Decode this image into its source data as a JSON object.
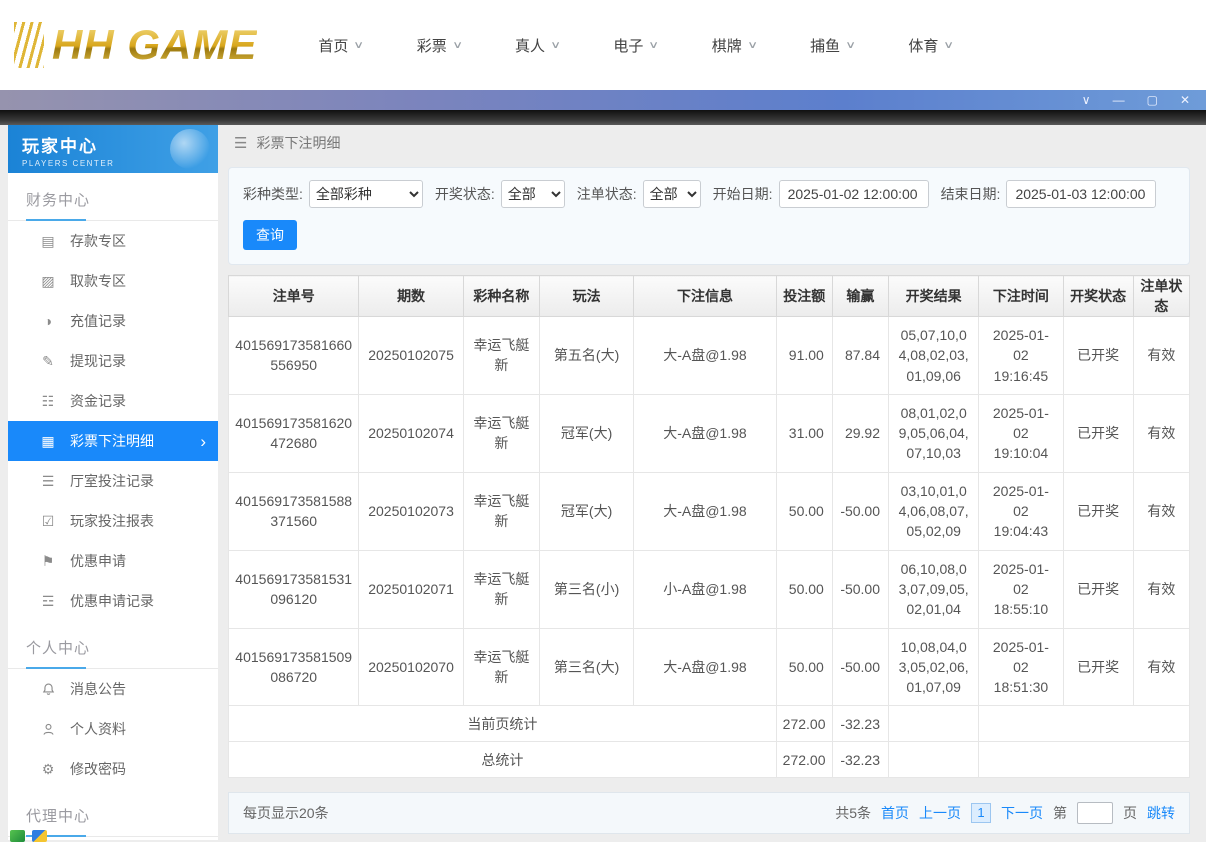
{
  "colors": {
    "accent": "#1989fa",
    "brand_gold": "#d8a61c",
    "sidebar_header_blue": "#1b83d6",
    "titlebar_purple": "#7b84bd"
  },
  "icons": {
    "chevron_down": "∨",
    "chevron_right": "›",
    "menu": "☰",
    "win_dropdown": "∨",
    "win_min": "—",
    "win_max": "▢",
    "win_close": "✕",
    "deposit": "▤",
    "withdraw": "▨",
    "recharge_record": "◑",
    "withdraw_record": "✎",
    "fund_record": "☷",
    "bet_detail": "▦",
    "hall_record": "☰",
    "report": "☑",
    "promo": "⚑",
    "promo_record": "☲",
    "gear": "⚙"
  },
  "topnav": {
    "logo": "HH GAME",
    "items": [
      {
        "label": "首页"
      },
      {
        "label": "彩票"
      },
      {
        "label": "真人"
      },
      {
        "label": "电子"
      },
      {
        "label": "棋牌"
      },
      {
        "label": "捕鱼"
      },
      {
        "label": "体育"
      }
    ]
  },
  "sidebar": {
    "title": "玩家中心",
    "subtitle": "PLAYERS CENTER",
    "sections": [
      {
        "title": "财务中心",
        "items": [
          {
            "label": "存款专区"
          },
          {
            "label": "取款专区"
          },
          {
            "label": "充值记录"
          },
          {
            "label": "提现记录"
          },
          {
            "label": "资金记录"
          },
          {
            "label": "彩票下注明细"
          },
          {
            "label": "厅室投注记录"
          },
          {
            "label": "玩家投注报表"
          },
          {
            "label": "优惠申请"
          },
          {
            "label": "优惠申请记录"
          }
        ]
      },
      {
        "title": "个人中心",
        "items": [
          {
            "label": "消息公告"
          },
          {
            "label": "个人资料"
          },
          {
            "label": "修改密码"
          }
        ]
      },
      {
        "title": "代理中心",
        "items": []
      }
    ]
  },
  "breadcrumb": {
    "title": "彩票下注明细"
  },
  "filters": {
    "lottery_type_label": "彩种类型:",
    "lottery_type_value": "全部彩种",
    "draw_status_label": "开奖状态:",
    "draw_status_value": "全部",
    "order_status_label": "注单状态:",
    "order_status_value": "全部",
    "start_date_label": "开始日期:",
    "start_date_value": "2025-01-02 12:00:00",
    "end_date_label": "结束日期:",
    "end_date_value": "2025-01-03 12:00:00",
    "search_button": "查询"
  },
  "table": {
    "headers": [
      "注单号",
      "期数",
      "彩种名称",
      "玩法",
      "下注信息",
      "投注额",
      "输赢",
      "开奖结果",
      "下注时间",
      "开奖状态",
      "注单状态"
    ],
    "rows": [
      {
        "order_no": "401569173581660556950",
        "issue": "20250102075",
        "lottery": "幸运飞艇新",
        "play": "第五名(大)",
        "bet_info": "大-A盘@1.98",
        "amount": "91.00",
        "win_loss": "87.84",
        "result": "05,07,10,04,08,02,03,01,09,06",
        "bet_time": "2025-01-02 19:16:45",
        "draw_status": "已开奖",
        "order_status": "有效"
      },
      {
        "order_no": "401569173581620472680",
        "issue": "20250102074",
        "lottery": "幸运飞艇新",
        "play": "冠军(大)",
        "bet_info": "大-A盘@1.98",
        "amount": "31.00",
        "win_loss": "29.92",
        "result": "08,01,02,09,05,06,04,07,10,03",
        "bet_time": "2025-01-02 19:10:04",
        "draw_status": "已开奖",
        "order_status": "有效"
      },
      {
        "order_no": "401569173581588371560",
        "issue": "20250102073",
        "lottery": "幸运飞艇新",
        "play": "冠军(大)",
        "bet_info": "大-A盘@1.98",
        "amount": "50.00",
        "win_loss": "-50.00",
        "result": "03,10,01,04,06,08,07,05,02,09",
        "bet_time": "2025-01-02 19:04:43",
        "draw_status": "已开奖",
        "order_status": "有效"
      },
      {
        "order_no": "401569173581531096120",
        "issue": "20250102071",
        "lottery": "幸运飞艇新",
        "play": "第三名(小)",
        "bet_info": "小-A盘@1.98",
        "amount": "50.00",
        "win_loss": "-50.00",
        "result": "06,10,08,03,07,09,05,02,01,04",
        "bet_time": "2025-01-02 18:55:10",
        "draw_status": "已开奖",
        "order_status": "有效"
      },
      {
        "order_no": "401569173581509086720",
        "issue": "20250102070",
        "lottery": "幸运飞艇新",
        "play": "第三名(大)",
        "bet_info": "大-A盘@1.98",
        "amount": "50.00",
        "win_loss": "-50.00",
        "result": "10,08,04,03,05,02,06,01,07,09",
        "bet_time": "2025-01-02 18:51:30",
        "draw_status": "已开奖",
        "order_status": "有效"
      }
    ],
    "summary": [
      {
        "label": "当前页统计",
        "amount": "272.00",
        "win_loss": "-32.23"
      },
      {
        "label": "总统计",
        "amount": "272.00",
        "win_loss": "-32.23"
      }
    ]
  },
  "pagination": {
    "page_size_text": "每页显示20条",
    "total_text": "共5条",
    "first": "首页",
    "prev": "上一页",
    "current_page": "1",
    "next": "下一页",
    "jump_prefix": "第",
    "jump_suffix": "页",
    "jump_button": "跳转"
  }
}
